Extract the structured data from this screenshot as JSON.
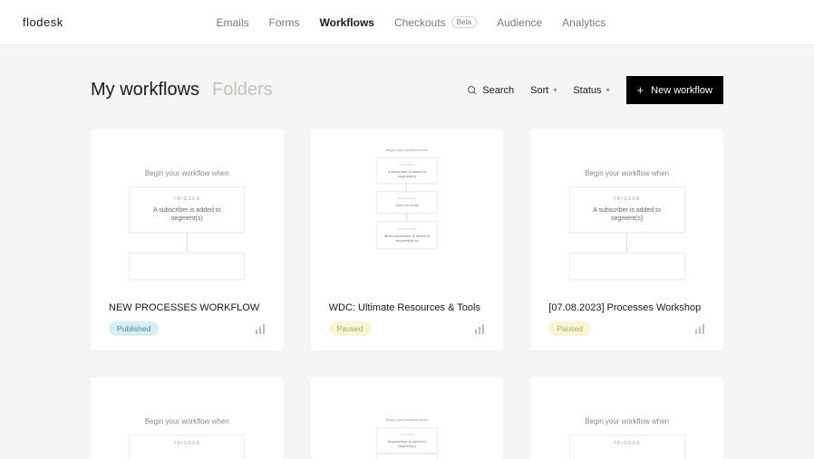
{
  "brand": "flodesk",
  "nav": {
    "emails": "Emails",
    "forms": "Forms",
    "workflows": "Workflows",
    "checkouts": "Checkouts",
    "beta": "Beta",
    "audience": "Audience",
    "analytics": "Analytics"
  },
  "tabs": {
    "my_workflows": "My workflows",
    "folders": "Folders"
  },
  "controls": {
    "search": "Search",
    "sort": "Sort",
    "status": "Status",
    "new_workflow": "New workflow"
  },
  "preview": {
    "begin": "Begin your workflow when",
    "trigger_label": "TRIGGER",
    "trigger_text": "A subscriber is added to segment(s)",
    "send_email_label": "SEND EMAIL",
    "send_email_text": "Send an email",
    "condition_label": "CONDITION",
    "condition_text": "When subscriber is added to segment(s) do"
  },
  "cards": [
    {
      "title": "NEW PROCESSES WORKFLOW",
      "status": "Published",
      "status_class": "status-published",
      "preview": "simple"
    },
    {
      "title": "WDC: Ultimate Resources & Tools",
      "status": "Paused",
      "status_class": "status-paused",
      "preview": "complex"
    },
    {
      "title": "[07.08.2023] Processes Workshop",
      "status": "Paused",
      "status_class": "status-paused",
      "preview": "simple"
    }
  ]
}
